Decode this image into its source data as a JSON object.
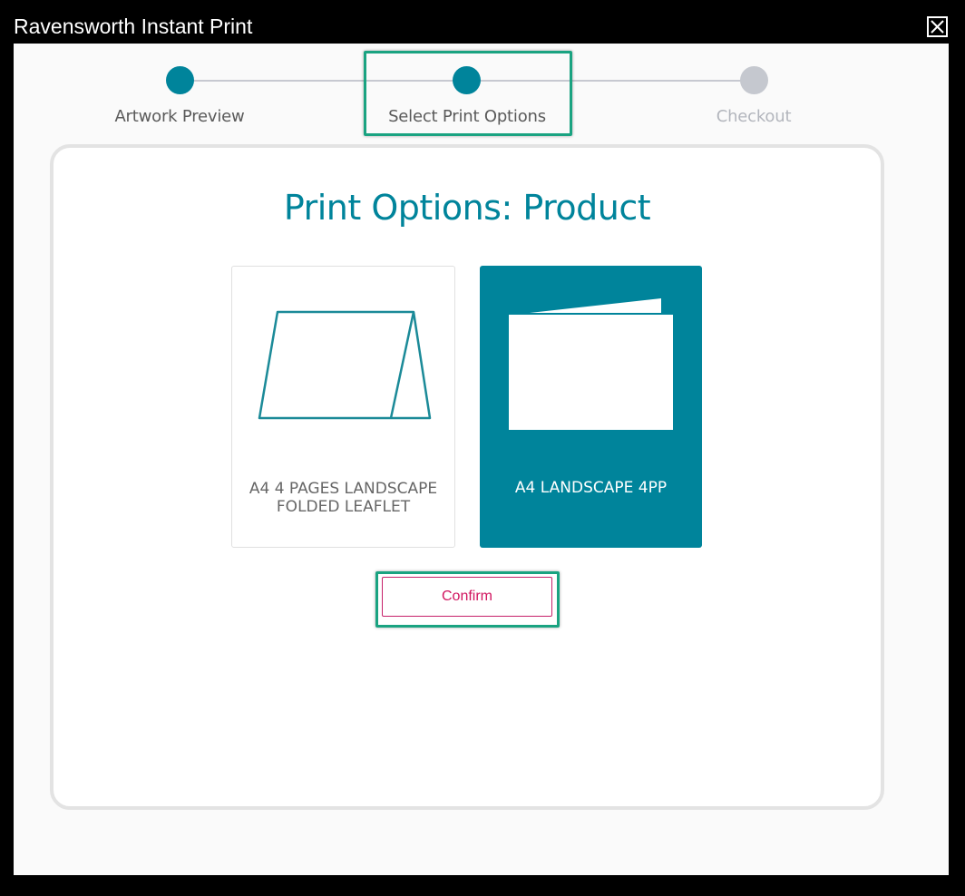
{
  "window": {
    "title": "Ravensworth Instant Print",
    "close_icon": "close-icon"
  },
  "stepper": {
    "steps": [
      {
        "label": "Artwork Preview",
        "state": "done"
      },
      {
        "label": "Select Print Options",
        "state": "current"
      },
      {
        "label": "Checkout",
        "state": "future"
      }
    ]
  },
  "panel": {
    "title": "Print Options: Product",
    "options": [
      {
        "label": "A4 4 PAGES LANDSCAPE FOLDED LEAFLET",
        "selected": false,
        "icon": "tent-fold-icon"
      },
      {
        "label": "A4 LANDSCAPE 4PP",
        "selected": true,
        "icon": "landscape-fold-icon"
      }
    ],
    "confirm_label": "Confirm"
  },
  "colors": {
    "accent": "#00849b",
    "inactive_step": "#c5c8cf",
    "confirm_text": "#d1155f",
    "highlight": "#1aa381"
  }
}
